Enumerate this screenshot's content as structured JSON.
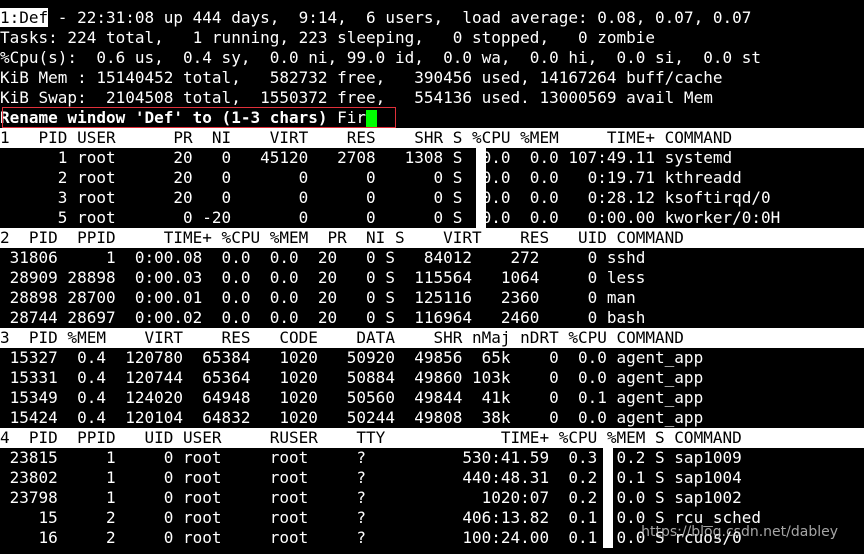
{
  "summary": [
    "1:Def - 22:31:08 up 444 days,  9:14,  6 users,  load average: 0.08, 0.07, 0.07",
    "Tasks: 224 total,   1 running, 223 sleeping,   0 stopped,   0 zombie",
    "%Cpu(s):  0.6 us,  0.4 sy,  0.0 ni, 99.0 id,  0.0 wa,  0.0 hi,  0.0 si,  0.0 st",
    "KiB Mem : 15140452 total,   582732 free,   390456 used, 14167264 buff/cache",
    "KiB Swap:  2104508 total,  1550372 free,   554136 used. 13000569 avail Mem"
  ],
  "window_label": "1:Def",
  "prompt": {
    "text": "Rename window 'Def' to (1-3 chars) ",
    "input_value": "Fir"
  },
  "windows": [
    {
      "header": "1   PID USER      PR  NI    VIRT    RES    SHR S %CPU %MEM     TIME+ COMMAND",
      "rows": [
        "      1 root      20   0   45120   2708   1308 S  0.0  0.0 107:49.11 systemd",
        "      2 root      20   0       0      0      0 S  0.0  0.0   0:19.71 kthreadd",
        "      3 root      20   0       0      0      0 S  0.0  0.0   0:28.12 ksoftirqd/0",
        "      5 root       0 -20       0      0      0 S  0.0  0.0   0:00.00 kworker/0:0H"
      ]
    },
    {
      "header": "2  PID  PPID     TIME+ %CPU %MEM  PR  NI S    VIRT    RES   UID COMMAND",
      "rows": [
        " 31806     1  0:00.08  0.0  0.0  20   0 S   84012    272     0 sshd",
        " 28909 28898  0:00.03  0.0  0.0  20   0 S  115564   1064     0 less",
        " 28898 28700  0:00.01  0.0  0.0  20   0 S  125116   2360     0 man",
        " 28744 28697  0:00.02  0.0  0.0  20   0 S  116964   2460     0 bash"
      ]
    },
    {
      "header": "3  PID %MEM    VIRT    RES   CODE    DATA    SHR nMaj nDRT %CPU COMMAND",
      "rows": [
        " 15327  0.4  120780  65384   1020   50920  49856  65k    0  0.0 agent_app",
        " 15331  0.4  120744  65364   1020   50884  49860 103k    0  0.0 agent_app",
        " 15349  0.4  124020  64948   1020   50560  49844  41k    0  0.1 agent_app",
        " 15424  0.4  120104  64832   1020   50244  49808  38k    0  0.0 agent_app"
      ]
    },
    {
      "header": "4  PID  PPID   UID USER     RUSER    TTY            TIME+ %CPU %MEM S COMMAND",
      "rows": [
        " 23815     1     0 root     root     ?          530:41.59  0.3  0.2 S sap1009",
        " 23802     1     0 root     root     ?          440:48.31  0.2  0.1 S sap1004",
        " 23798     1     0 root     root     ?            1020:07  0.2  0.0 S sap1002",
        "    15     2     0 root     root     ?          406:13.82  0.1  0.0 S rcu_sched",
        "    16     2     0 root     root     ?          100:24.00  0.1  0.0 S rcuos/0"
      ]
    }
  ],
  "watermark": "https://blog.csdn.net/dabley"
}
